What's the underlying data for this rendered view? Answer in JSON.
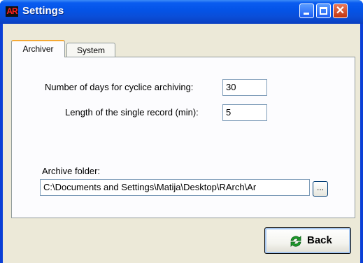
{
  "window": {
    "title": "Settings",
    "app_icon_text": "AR"
  },
  "tabs": [
    {
      "label": "Archiver",
      "active": true
    },
    {
      "label": "System",
      "active": false
    }
  ],
  "archiver": {
    "days_label": "Number of days for cyclice archiving:",
    "days_value": "30",
    "record_label": "Length of the single record (min):",
    "record_value": "5",
    "folder_label": "Archive folder:",
    "folder_value": "C:\\Documents and Settings\\Matija\\Desktop\\RArch\\Ar",
    "browse_label": "..."
  },
  "footer": {
    "back_label": "Back",
    "back_icon": "refresh-icon"
  },
  "colors": {
    "titlebar": "#0a5cf0",
    "face": "#ece9d8",
    "active_tab_highlight": "#f5a934",
    "icon_green": "#1c9a2a"
  }
}
